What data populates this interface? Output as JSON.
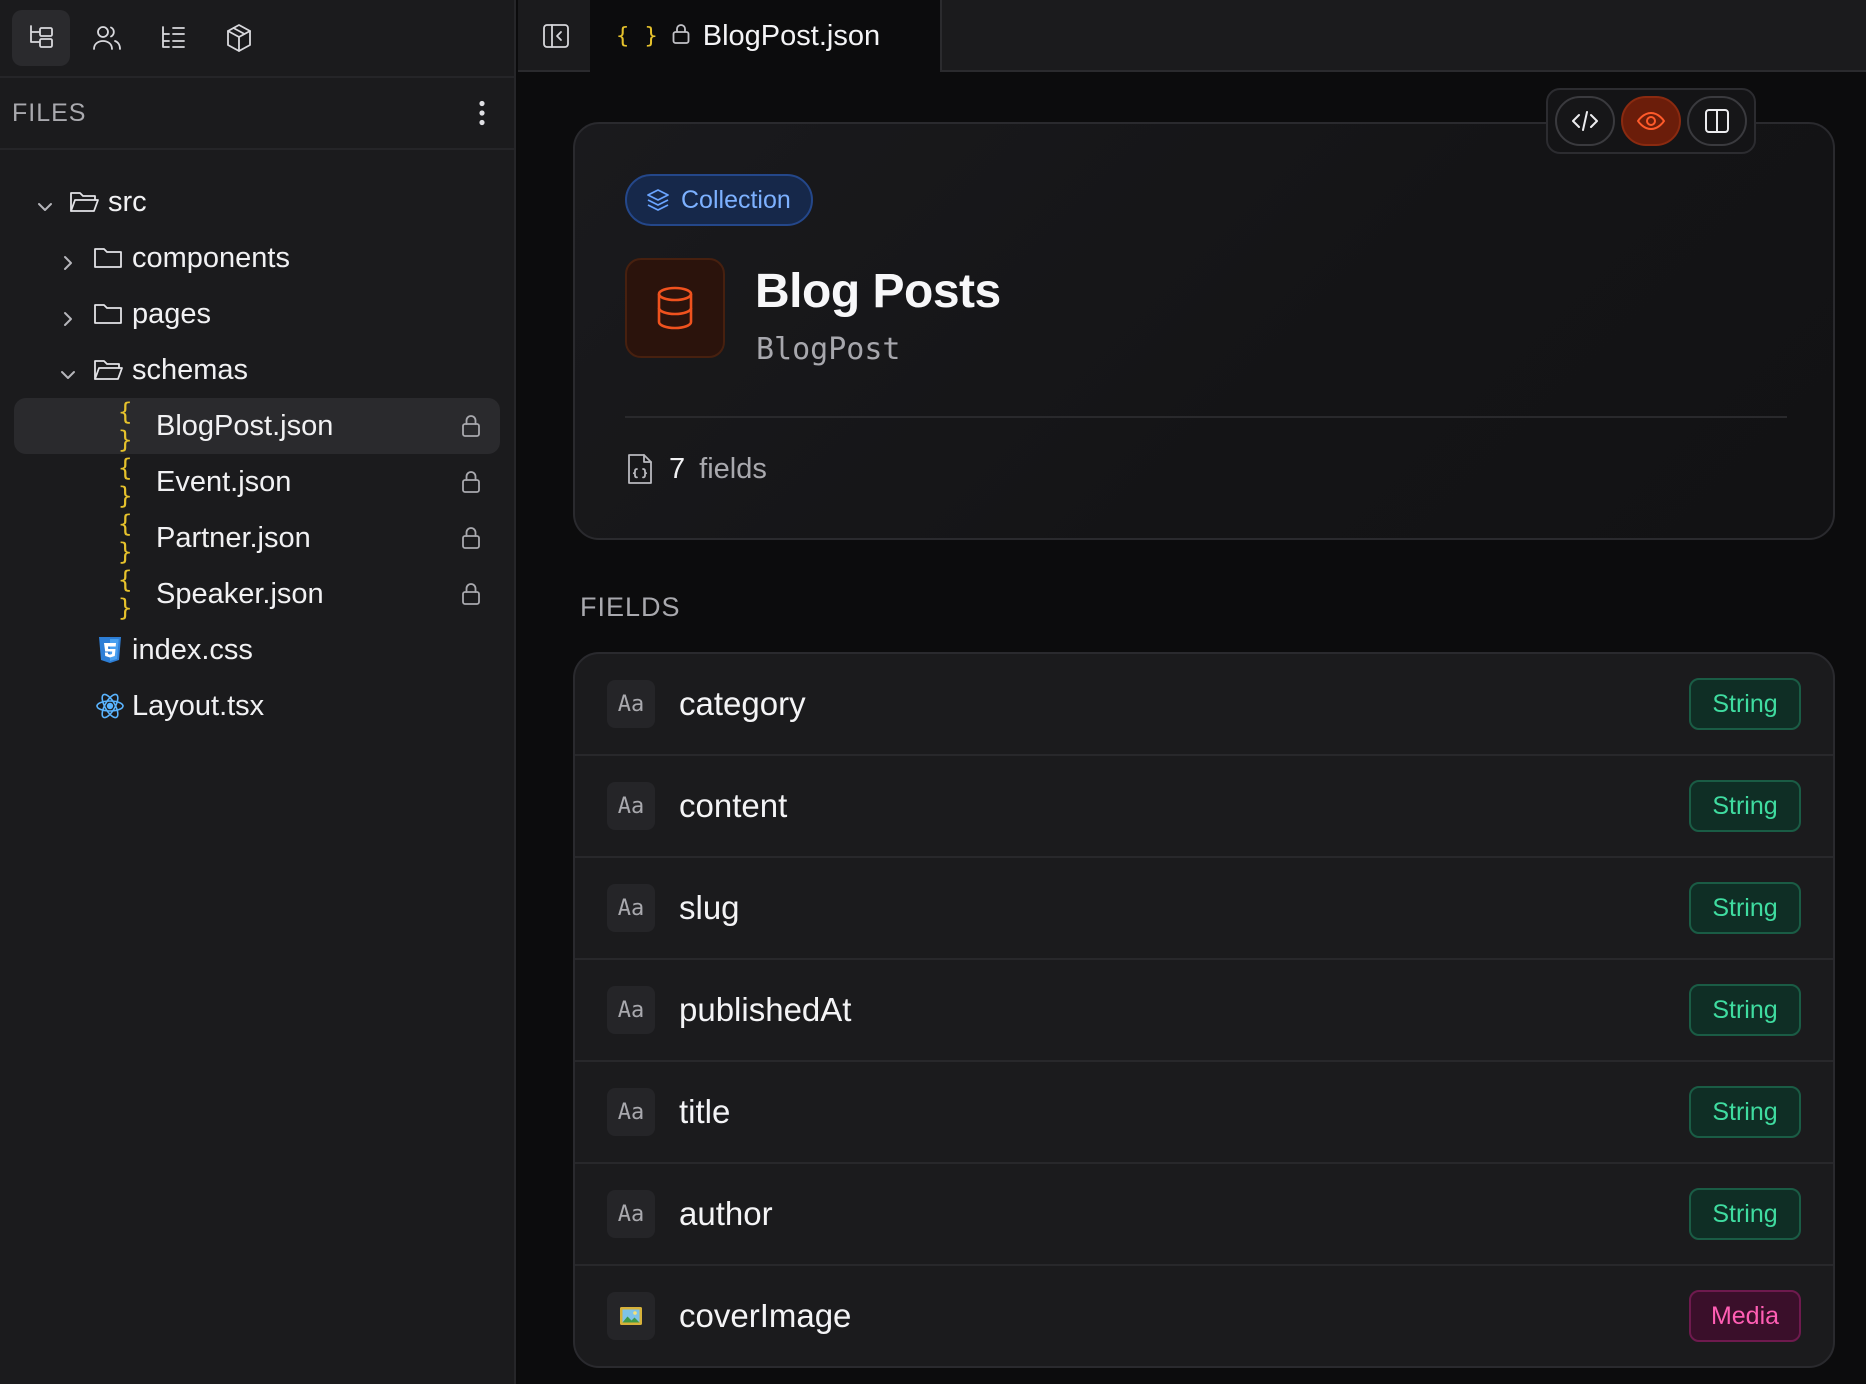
{
  "sidebar": {
    "files_title": "FILES",
    "tree": [
      {
        "label": "src",
        "kind": "folder-open",
        "expanded": true
      },
      {
        "label": "components",
        "kind": "folder",
        "expanded": false
      },
      {
        "label": "pages",
        "kind": "folder",
        "expanded": false
      },
      {
        "label": "schemas",
        "kind": "folder-open",
        "expanded": true
      },
      {
        "label": "BlogPost.json",
        "kind": "json",
        "locked": true,
        "selected": true
      },
      {
        "label": "Event.json",
        "kind": "json",
        "locked": true
      },
      {
        "label": "Partner.json",
        "kind": "json",
        "locked": true
      },
      {
        "label": "Speaker.json",
        "kind": "json",
        "locked": true
      },
      {
        "label": "index.css",
        "kind": "css"
      },
      {
        "label": "Layout.tsx",
        "kind": "react"
      }
    ],
    "json_glyph": "{ }"
  },
  "tabs": [
    {
      "label": "BlogPost.json",
      "icon": "json-braces-icon",
      "locked": true,
      "active": true
    }
  ],
  "tab_glyph": "{ }",
  "view_modes": [
    "code",
    "preview",
    "split"
  ],
  "active_view": "preview",
  "collection": {
    "badge": "Collection",
    "title": "Blog Posts",
    "id": "BlogPost",
    "field_count": "7",
    "field_count_label": "fields"
  },
  "fields_section_label": "FIELDS",
  "type_chip_text": "Aa",
  "fields": [
    {
      "name": "category",
      "type": "String"
    },
    {
      "name": "content",
      "type": "String"
    },
    {
      "name": "slug",
      "type": "String"
    },
    {
      "name": "publishedAt",
      "type": "String"
    },
    {
      "name": "title",
      "type": "String"
    },
    {
      "name": "author",
      "type": "String"
    },
    {
      "name": "coverImage",
      "type": "Media"
    }
  ],
  "colors": {
    "accent_orange": "#f0521e",
    "collection_blue": "#7db1ff",
    "string_green": "#3fdca0",
    "media_pink": "#ff5eb4",
    "json_yellow": "#e6c22c"
  }
}
